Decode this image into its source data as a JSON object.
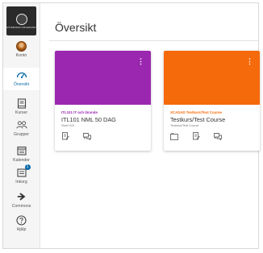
{
  "logo": {
    "text": "GÖTEBORGS UNIVERSITET"
  },
  "nav": {
    "items": [
      {
        "label": "Konto",
        "icon": "avatar"
      },
      {
        "label": "Översikt",
        "icon": "dashboard-icon"
      },
      {
        "label": "Kurser",
        "icon": "book-icon"
      },
      {
        "label": "Grupper",
        "icon": "groups-icon"
      },
      {
        "label": "Kalender",
        "icon": "calendar-icon"
      },
      {
        "label": "Inkorg",
        "icon": "inbox-icon",
        "badge": "1"
      },
      {
        "label": "Commons",
        "icon": "commons-icon"
      },
      {
        "label": "Hjälp",
        "icon": "help-icon"
      }
    ],
    "active_item": "Översikt"
  },
  "page": {
    "title": "Översikt"
  },
  "cards": [
    {
      "color": "#9b27b0",
      "subtitle": "ITL101 IT och lärande",
      "name": "ITL101 NML 50 DAG",
      "term": "Start H19",
      "actions": [
        "assignments-icon",
        "discussions-icon"
      ]
    },
    {
      "color": "#f56a0a",
      "subtitle": "XCASAD Testkurs/Test Course",
      "name": "Testkurs/Test Course",
      "term": "Testkurs/Test Course",
      "actions": [
        "announcements-icon",
        "assignments-icon",
        "discussions-icon"
      ]
    }
  ],
  "colors": {
    "accent": "#0a6aa8",
    "nav_background": "#f5f5f5"
  }
}
